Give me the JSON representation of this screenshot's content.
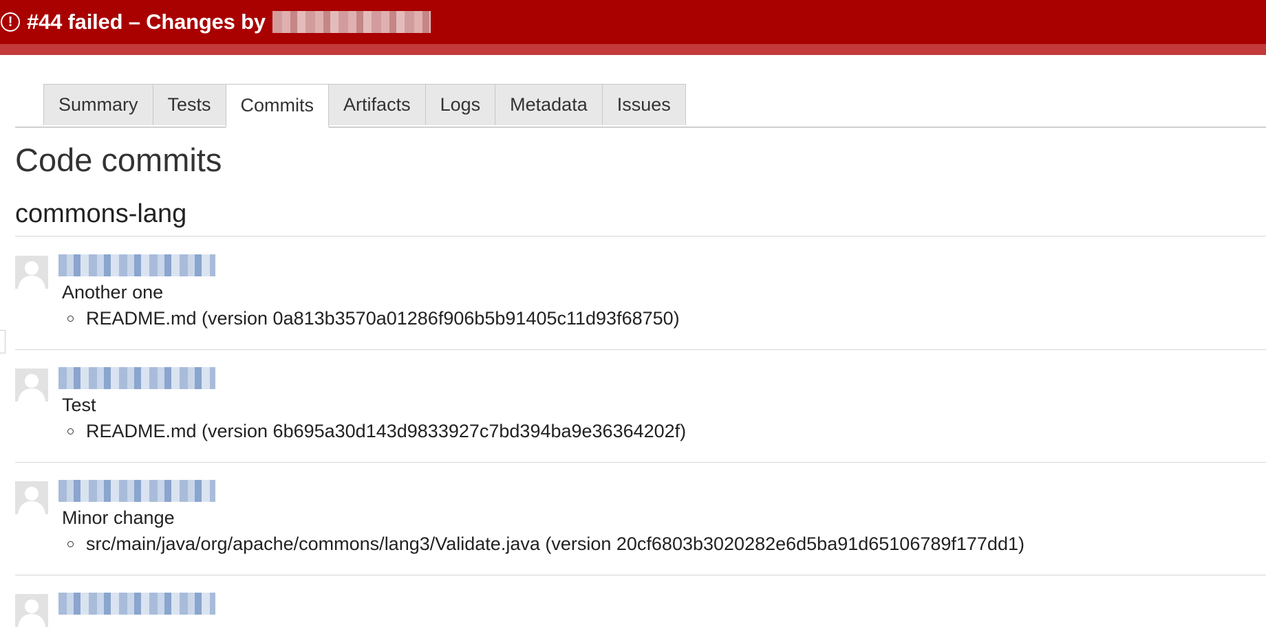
{
  "banner": {
    "title": "#44 failed – Changes by",
    "alert_glyph": "!",
    "bg_color": "#a90000"
  },
  "tabs": [
    {
      "label": "Summary"
    },
    {
      "label": "Tests"
    },
    {
      "label": "Commits",
      "active": true
    },
    {
      "label": "Artifacts"
    },
    {
      "label": "Logs"
    },
    {
      "label": "Metadata"
    },
    {
      "label": "Issues"
    }
  ],
  "page": {
    "title": "Code commits",
    "repository": "commons-lang"
  },
  "commits": [
    {
      "message": "Another one",
      "file": "README.md (version 0a813b3570a01286f906b5b91405c11d93f68750)"
    },
    {
      "message": "Test",
      "file": "README.md (version 6b695a30d143d9833927c7bd394ba9e36364202f)"
    },
    {
      "message": "Minor change",
      "file": "src/main/java/org/apache/commons/lang3/Validate.java (version 20cf6803b3020282e6d5ba91d65106789f177dd1)"
    }
  ]
}
